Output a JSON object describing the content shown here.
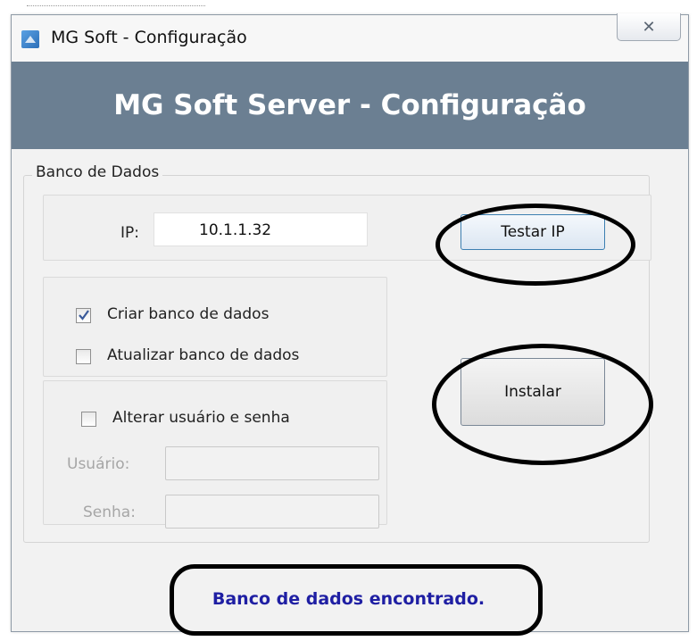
{
  "window": {
    "title": "MG Soft - Configuração",
    "close_glyph": "✕"
  },
  "banner": {
    "title": "MG Soft Server - Configuração"
  },
  "database_group": {
    "legend": "Banco de Dados",
    "ip_label": "IP:",
    "ip_value": "10.1.1.32",
    "test_ip_button": "Testar IP",
    "create_db_label": "Criar banco de dados",
    "create_db_checked": true,
    "update_db_label": "Atualizar banco de dados",
    "update_db_checked": false,
    "change_user_label": "Alterar usuário e senha",
    "change_user_checked": false,
    "user_label": "Usuário:",
    "password_label": "Senha:",
    "install_button": "Instalar"
  },
  "status": {
    "message": "Banco de dados encontrado."
  },
  "colors": {
    "banner": "#6b7f92",
    "status_text": "#1f1fa3",
    "annotation": "#000000"
  },
  "icons": {
    "app": "app-icon",
    "close": "close-icon",
    "check": "checkmark-icon"
  }
}
